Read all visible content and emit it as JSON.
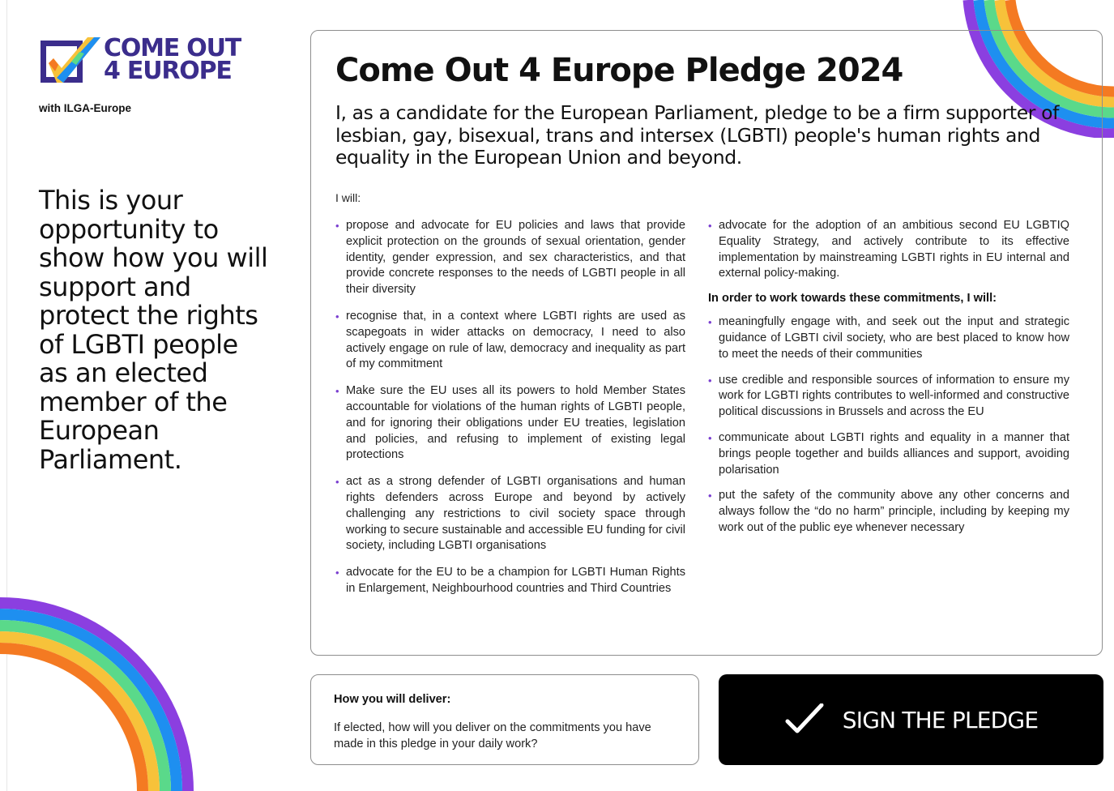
{
  "brand": {
    "logo_line1": "COME OUT",
    "logo_line2": "4 EUROPE",
    "with": "with ILGA-Europe",
    "colors": {
      "purple": "#3b2d8c",
      "violet": "#8b3fe0",
      "blue": "#1e8ff0",
      "green": "#5ad98a",
      "yellow": "#f7c23a",
      "orange": "#f47a22"
    }
  },
  "tagline": "This is your opportunity to show how you will support and protect the rights of LGBTI people as an elected member of the European Parliament.",
  "pledge": {
    "title": "Come Out 4 Europe Pledge 2024",
    "intro": "I, as a candidate for the European Parliament, pledge to be a firm supporter of lesbian, gay, bisexual, trans and intersex (LGBTI) people's human rights and equality in the European Union and beyond.",
    "i_will": "I will:",
    "left_items": [
      "propose and advocate for EU policies and laws that provide explicit protection on the grounds of sexual orientation, gender identity, gender expression, and sex characteristics, and that provide concrete responses to the needs of LGBTI people in all their diversity",
      "recognise that, in a context where LGBTI rights are used as scapegoats in wider attacks on democracy, I need to also actively engage on rule of law, democracy and inequality as part of my commitment",
      "Make sure the EU uses all its powers to hold Member States accountable for violations of the human rights of LGBTI people, and for ignoring their obligations under EU treaties, legislation and policies, and refusing to implement of existing legal protections",
      "act as a strong defender of LGBTI organisations and human rights defenders across Europe and beyond by actively challenging any restrictions to civil society space through working to secure sustainable and accessible EU funding for civil society, including LGBTI organisations",
      "advocate for the EU to be a champion for LGBTI Human Rights in Enlargement, Neighbourhood countries and Third Countries"
    ],
    "right_first_item": "advocate for the adoption of an ambitious second EU LGBTIQ Equality Strategy, and actively contribute to its effective implementation by mainstreaming LGBTI rights in EU internal and external policy-making.",
    "right_heading": "In order to work towards these commitments, I will:",
    "right_items": [
      "meaningfully engage with, and seek out the input and strategic guidance of LGBTI civil society, who are best placed to know how to meet the needs of their communities",
      "use credible and responsible sources of information to ensure my work for LGBTI rights contributes to well-informed and constructive political discussions in Brussels and across the EU",
      "communicate about LGBTI rights and equality in a manner that brings people together and builds alliances and support, avoiding polarisation",
      "put the safety of the community above any other concerns and always follow the “do no harm” principle, including by keeping my work out of the public eye whenever necessary"
    ]
  },
  "deliver": {
    "heading": "How you will deliver:",
    "text": "If elected, how will you deliver on the commitments you have made in this pledge in your daily work?"
  },
  "sign": {
    "label": "SIGN THE PLEDGE",
    "icon": "check-icon"
  }
}
